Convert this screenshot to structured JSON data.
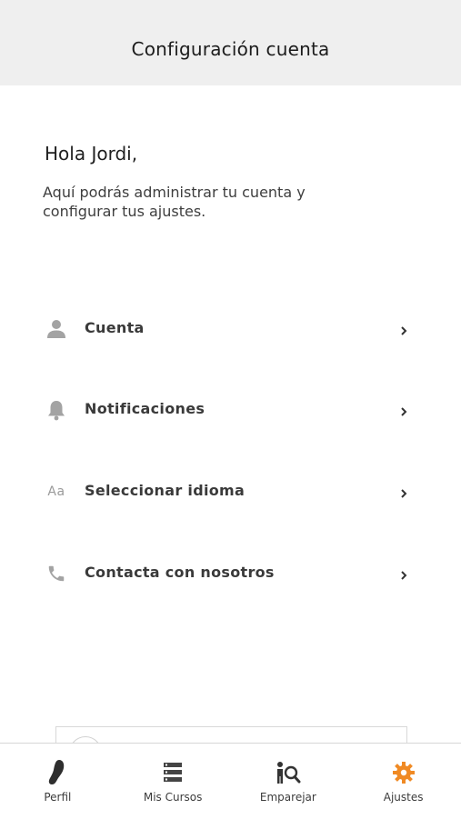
{
  "header": {
    "title": "Configuración cuenta"
  },
  "greeting": "Hola Jordi,",
  "intro": "Aquí podrás administrar tu cuenta y configurar tus ajustes.",
  "menu": [
    {
      "label": "Cuenta",
      "icon": "person-icon"
    },
    {
      "label": "Notificaciones",
      "icon": "bell-icon"
    },
    {
      "label": "Seleccionar idioma",
      "icon": "language-icon",
      "icon_text": "Aa"
    },
    {
      "label": "Contacta con nosotros",
      "icon": "phone-icon"
    }
  ],
  "tabbar": {
    "active_color": "#f08a24",
    "items": [
      {
        "label": "Perfil",
        "icon": "footprint-icon"
      },
      {
        "label": "Mis Cursos",
        "icon": "list-icon"
      },
      {
        "label": "Emparejar",
        "icon": "match-search-icon"
      },
      {
        "label": "Ajustes",
        "icon": "gear-icon",
        "active": true
      }
    ]
  }
}
